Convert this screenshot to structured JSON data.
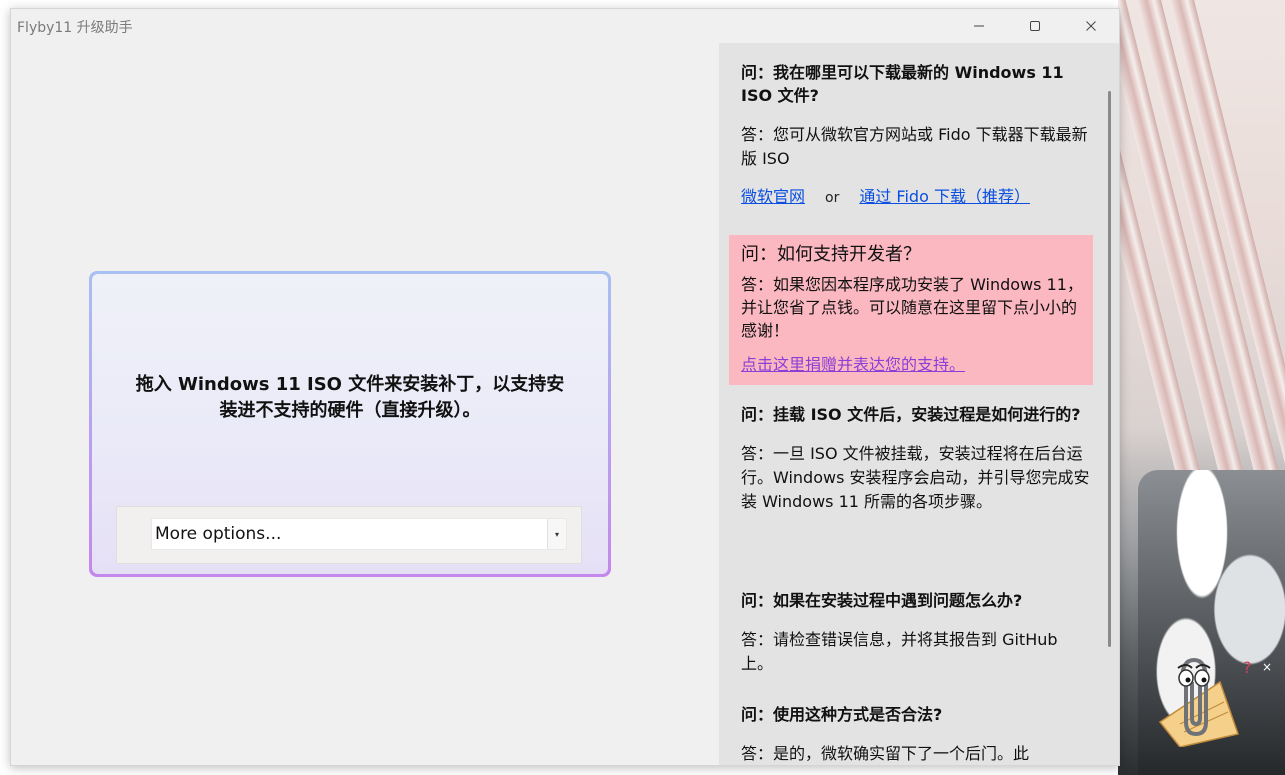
{
  "window": {
    "title": "Flyby11 升级助手",
    "minimize_glyph": "—",
    "maximize_glyph": "☐",
    "close_glyph": "✕"
  },
  "drop_zone": {
    "instruction": "拖入 Windows 11 ISO 文件来安装补丁，以支持安装进不支持的硬件（直接升级）。",
    "options_selected": "More options...",
    "dropdown_glyph": "▾"
  },
  "faq": {
    "items": [
      {
        "question": "问：我在哪里可以下载最新的 Windows 11 ISO 文件?",
        "answer": "答：您可从微软官方网站或 Fido 下载器下载最新版 ISO",
        "link1": "微软官网",
        "or_text": "or",
        "link2": "通过 Fido 下载（推荐）"
      },
      {
        "question": "问：如何支持开发者？",
        "answer": "答：如果您因本程序成功安装了 Windows 11，并让您省了点钱。可以随意在这里留下点小小的感谢！",
        "link": "点击这里捐赠并表达您的支持。"
      },
      {
        "question": "问：挂载 ISO 文件后，安装过程是如何进行的?",
        "answer": "答：一旦 ISO 文件被挂载，安装过程将在后台运行。Windows 安装程序会启动，并引导您完成安装 Windows 11 所需的各项步骤。"
      },
      {
        "question": "问：如果在安装过程中遇到问题怎么办?",
        "answer": "答：请检查错误信息，并将其报告到 GitHub 上。"
      },
      {
        "question": "问：使用这种方式是否合法?",
        "answer": "答：是的，微软确实留下了一个后门。此"
      }
    ]
  },
  "assistant": {
    "icon": "paperclip-assistant-icon",
    "help_glyph": "?",
    "close_glyph": "×"
  },
  "colors": {
    "donate_bg": "#fbb8c1",
    "link": "#0b4fe0",
    "donate_link": "#8a3fd6",
    "card_border_top": "#a9c0f2",
    "card_border_bottom": "#c487ec"
  }
}
